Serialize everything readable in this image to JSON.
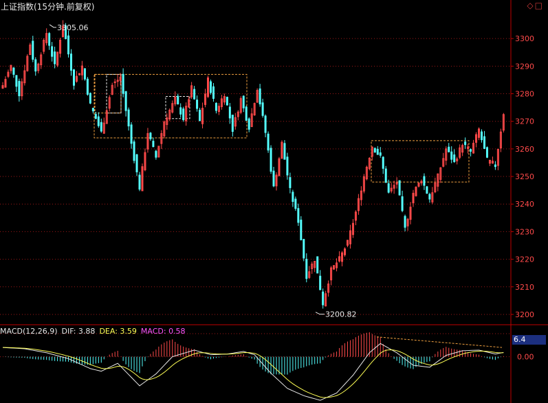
{
  "window": {
    "title": "上证指数(15分钟.前复权)",
    "buttons": [
      "◇",
      "□"
    ]
  },
  "macd_header": {
    "name": "MACD(12,26,9)",
    "dif_label": "DIF: 3.88",
    "dea_label": "DEA: 3.59",
    "macd_label": "MACD: 0.58",
    "value_box": "6.4"
  },
  "colors": {
    "up": "#ff4a4a",
    "down": "#54ffff",
    "grid": "#a01818",
    "axis": "#c00000",
    "box": "#f0a040",
    "box_white": "#e8e8e8",
    "dif": "#e8e8e8",
    "dea": "#ffff55"
  },
  "chart_data": [
    {
      "type": "candlestick",
      "title": "上证指数(15分钟.前复权)",
      "ylim": [
        3197,
        3310
      ],
      "yticks": [
        "3200",
        "3210",
        "3220",
        "3230",
        "3240",
        "3250",
        "3260",
        "3270",
        "3280",
        "3290",
        "3300"
      ],
      "grid": true,
      "annotations": {
        "high": "3305.06",
        "low": "3200.82"
      },
      "pivots": [
        [
          0,
          3283
        ],
        [
          3,
          3290
        ],
        [
          6,
          3280
        ],
        [
          10,
          3298
        ],
        [
          12,
          3288
        ],
        [
          16,
          3302
        ],
        [
          19,
          3290
        ],
        [
          22,
          3305
        ],
        [
          26,
          3284
        ],
        [
          29,
          3290
        ],
        [
          32,
          3276
        ],
        [
          36,
          3266
        ],
        [
          40,
          3283
        ],
        [
          43,
          3286
        ],
        [
          47,
          3262
        ],
        [
          50,
          3246
        ],
        [
          53,
          3266
        ],
        [
          56,
          3257
        ],
        [
          59,
          3270
        ],
        [
          63,
          3278
        ],
        [
          66,
          3271
        ],
        [
          69,
          3282
        ],
        [
          72,
          3270
        ],
        [
          75,
          3285
        ],
        [
          78,
          3274
        ],
        [
          81,
          3280
        ],
        [
          84,
          3267
        ],
        [
          87,
          3278
        ],
        [
          90,
          3268
        ],
        [
          93,
          3282
        ],
        [
          96,
          3266
        ],
        [
          99,
          3246
        ],
        [
          102,
          3262
        ],
        [
          105,
          3245
        ],
        [
          108,
          3234
        ],
        [
          111,
          3214
        ],
        [
          114,
          3220
        ],
        [
          117,
          3204
        ],
        [
          120,
          3216
        ],
        [
          123,
          3220
        ],
        [
          126,
          3226
        ],
        [
          129,
          3237
        ],
        [
          132,
          3250
        ],
        [
          135,
          3261
        ],
        [
          138,
          3257
        ],
        [
          141,
          3244
        ],
        [
          144,
          3248
        ],
        [
          147,
          3231
        ],
        [
          150,
          3244
        ],
        [
          153,
          3249
        ],
        [
          156,
          3242
        ],
        [
          159,
          3250
        ],
        [
          162,
          3260
        ],
        [
          165,
          3255
        ],
        [
          168,
          3262
        ],
        [
          171,
          3259
        ],
        [
          174,
          3267
        ],
        [
          177,
          3256
        ],
        [
          180,
          3254
        ],
        [
          183,
          3273
        ],
        [
          186,
          3268
        ]
      ],
      "boxes": [
        {
          "x0": 137,
          "x1": 359,
          "y0": 3264,
          "y1": 3287,
          "color": "box"
        },
        {
          "x0": 138,
          "x1": 176,
          "y0": 3273,
          "y1": 3287,
          "color": "box"
        },
        {
          "x0": 155,
          "x1": 176,
          "y0": 3273,
          "y1": 3287,
          "color": "box_white"
        },
        {
          "x0": 241,
          "x1": 276,
          "y0": 3271,
          "y1": 3279,
          "color": "box_white"
        },
        {
          "x0": 540,
          "x1": 682,
          "y0": 3248,
          "y1": 3263,
          "color": "box"
        }
      ]
    },
    {
      "type": "macd",
      "title": "MACD(12,26,9)",
      "ylim": [
        -6.8,
        3.8
      ],
      "yticks": [
        "0.00"
      ],
      "dif": 3.88,
      "dea": 3.59,
      "macd": 0.58,
      "pivots": [
        [
          0,
          1.4
        ],
        [
          8,
          1.2
        ],
        [
          16,
          0.6
        ],
        [
          24,
          -0.3
        ],
        [
          32,
          -1.8
        ],
        [
          36,
          -2.2
        ],
        [
          42,
          -1.0
        ],
        [
          50,
          -4.4
        ],
        [
          56,
          -2.6
        ],
        [
          62,
          0.0
        ],
        [
          70,
          1.0
        ],
        [
          76,
          0.3
        ],
        [
          82,
          0.4
        ],
        [
          88,
          0.8
        ],
        [
          92,
          0.3
        ],
        [
          98,
          -2.5
        ],
        [
          104,
          -4.8
        ],
        [
          110,
          -5.9
        ],
        [
          116,
          -6.6
        ],
        [
          122,
          -5.5
        ],
        [
          128,
          -2.8
        ],
        [
          134,
          0.6
        ],
        [
          138,
          2.0
        ],
        [
          144,
          0.6
        ],
        [
          150,
          -1.3
        ],
        [
          156,
          -1.6
        ],
        [
          162,
          0.2
        ],
        [
          168,
          0.9
        ],
        [
          174,
          1.0
        ],
        [
          180,
          0.4
        ],
        [
          186,
          0.9
        ]
      ]
    }
  ]
}
